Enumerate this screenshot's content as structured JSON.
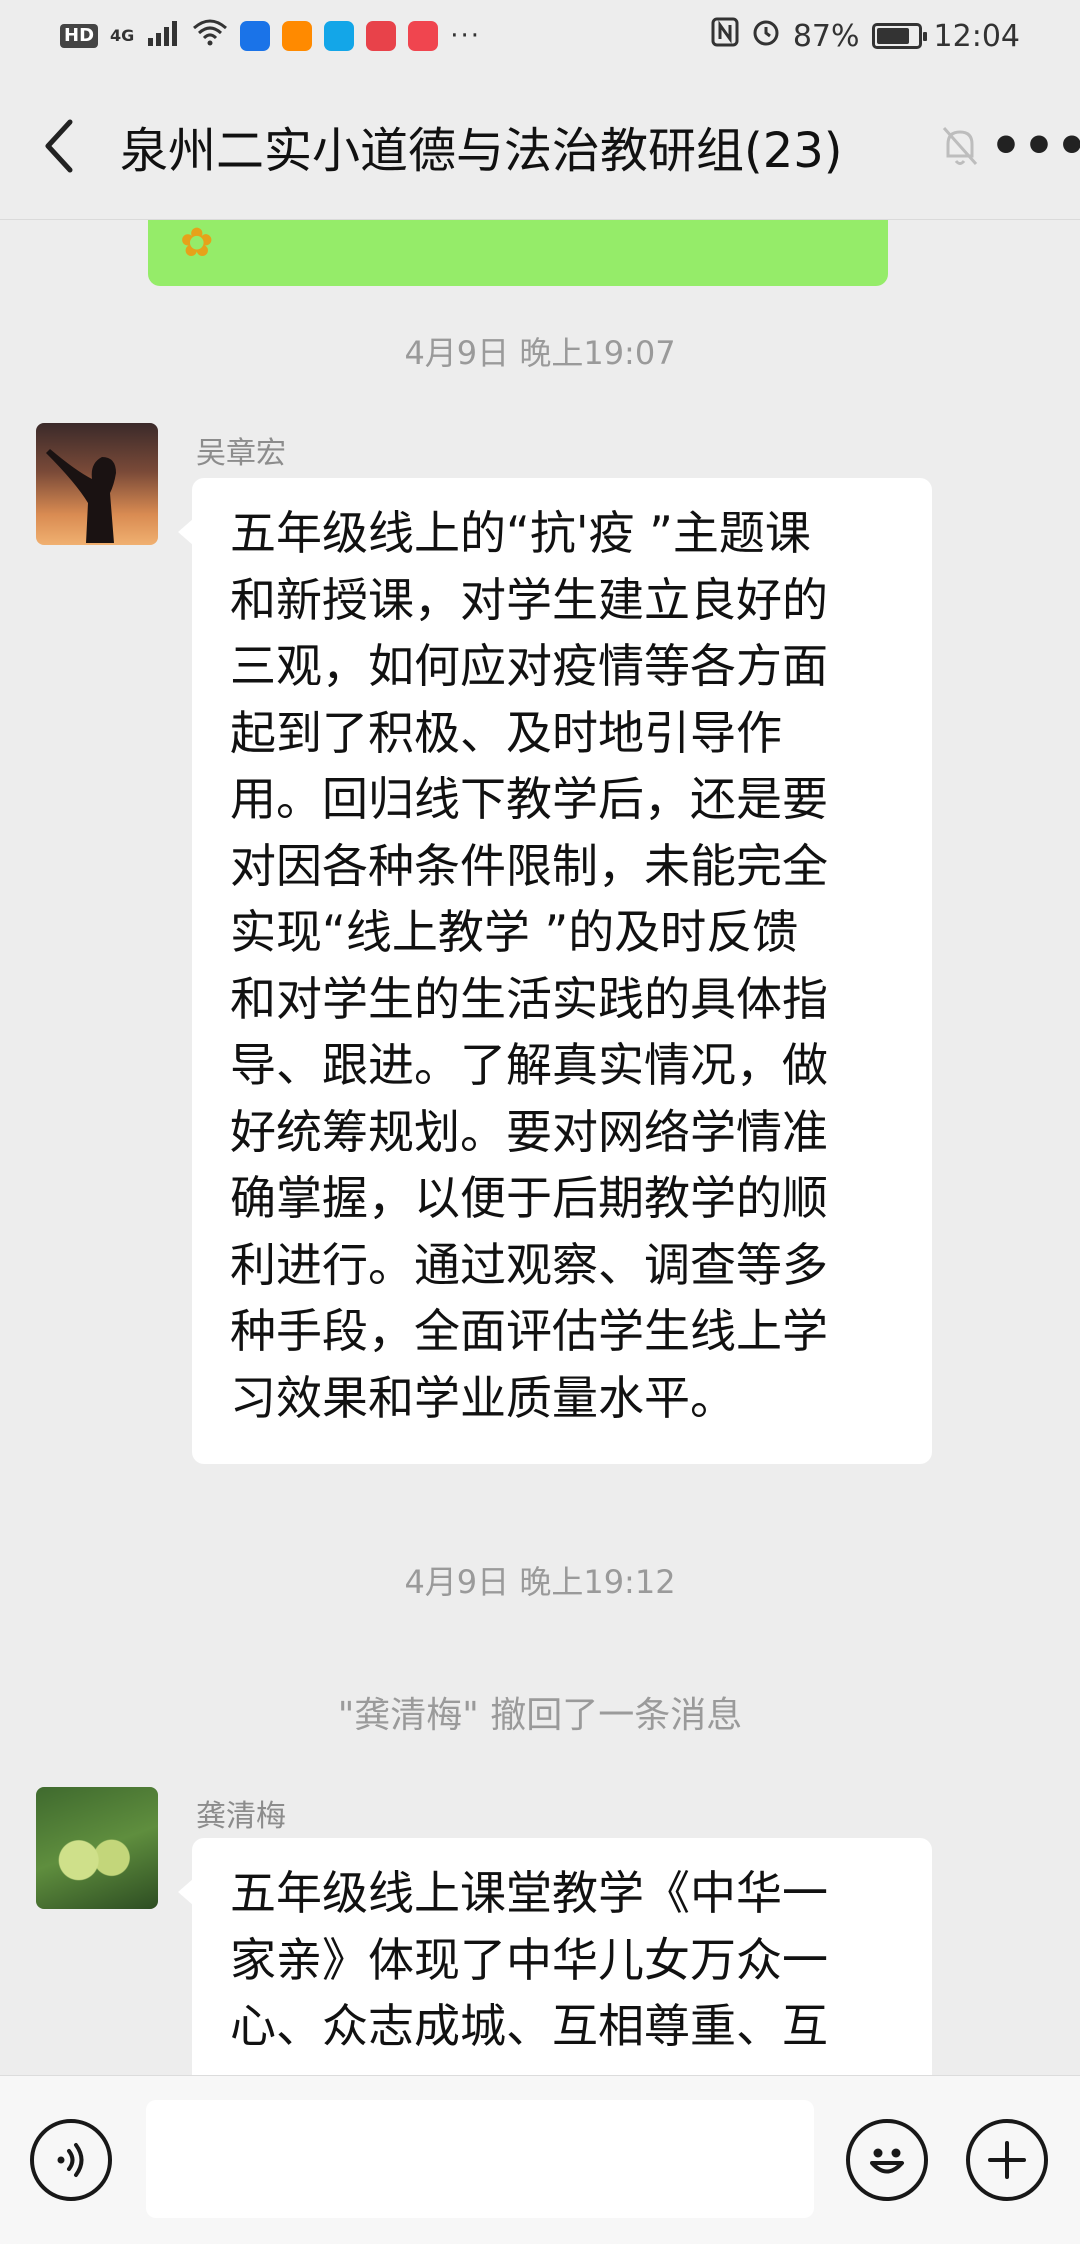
{
  "status_bar": {
    "hd": "HD",
    "network": "4G",
    "more": "···",
    "battery": "87%",
    "time": "12:04"
  },
  "header": {
    "title": "泉州二实小道德与法治教研组(23)",
    "more": "•••"
  },
  "messages": [
    {
      "timestamp": "4月9日 晚上19:07",
      "sender": "吴章宏",
      "lines": [
        "五年级线上的“抗'疫 ”主题课",
        "和新授课，对学生建立良好的",
        "三观，如何应对疫情等各方面",
        "起到了积极、及时地引导作",
        "用。回归线下教学后，还是要",
        "对因各种条件限制，未能完全",
        "实现“线上教学 ”的及时反馈",
        "和对学生的生活实践的具体指",
        "导、跟进。了解真实情况，做",
        "好统筹规划。要对网络学情准",
        "确掌握，以便于后期教学的顺",
        "利进行。通过观察、调查等多",
        "种手段，全面评估学生线上学",
        "习效果和学业质量水平。"
      ]
    },
    {
      "timestamp": "4月9日 晚上19:12",
      "recall_notice": "\"龚清梅\" 撤回了一条消息",
      "sender": "龚清梅",
      "lines": [
        "五年级线上课堂教学《中华一",
        "家亲》体现了中华儿女万众一",
        "心、众志成城、互相尊重、互"
      ]
    }
  ],
  "colors": {
    "background": "#ededed",
    "self_bubble": "#95ec69",
    "other_bubble": "#ffffff",
    "meta_text": "#9a9a9a"
  }
}
